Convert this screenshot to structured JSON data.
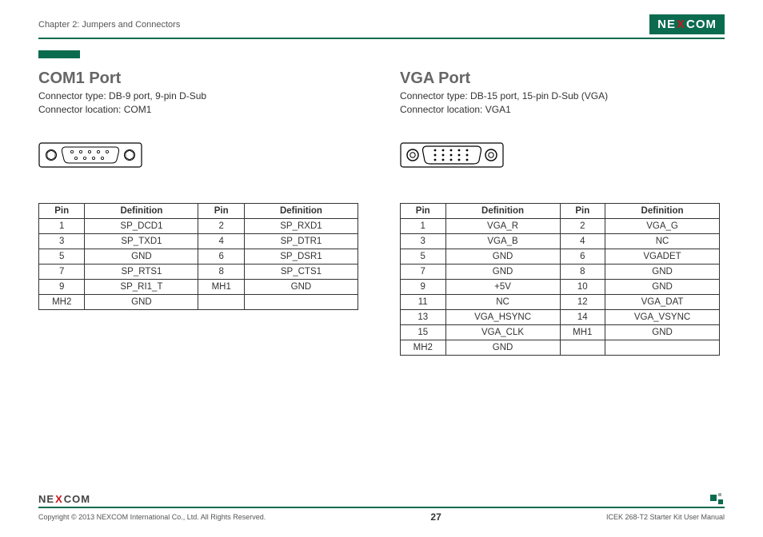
{
  "header": {
    "chapter": "Chapter 2: Jumpers and Connectors",
    "brand_left": "NE",
    "brand_x": "X",
    "brand_right": "COM"
  },
  "com1": {
    "title": "COM1 Port",
    "line1": "Connector type: DB-9 port, 9-pin D-Sub",
    "line2": "Connector location: COM1",
    "thead": {
      "pin": "Pin",
      "def": "Definition"
    },
    "rows": [
      {
        "p1": "1",
        "d1": "SP_DCD1",
        "p2": "2",
        "d2": "SP_RXD1"
      },
      {
        "p1": "3",
        "d1": "SP_TXD1",
        "p2": "4",
        "d2": "SP_DTR1"
      },
      {
        "p1": "5",
        "d1": "GND",
        "p2": "6",
        "d2": "SP_DSR1"
      },
      {
        "p1": "7",
        "d1": "SP_RTS1",
        "p2": "8",
        "d2": "SP_CTS1"
      },
      {
        "p1": "9",
        "d1": "SP_RI1_T",
        "p2": "MH1",
        "d2": "GND"
      },
      {
        "p1": "MH2",
        "d1": "GND",
        "p2": "",
        "d2": ""
      }
    ]
  },
  "vga": {
    "title": "VGA Port",
    "line1": "Connector type: DB-15 port, 15-pin D-Sub (VGA)",
    "line2": "Connector location: VGA1",
    "thead": {
      "pin": "Pin",
      "def": "Definition"
    },
    "rows": [
      {
        "p1": "1",
        "d1": "VGA_R",
        "p2": "2",
        "d2": "VGA_G"
      },
      {
        "p1": "3",
        "d1": "VGA_B",
        "p2": "4",
        "d2": "NC"
      },
      {
        "p1": "5",
        "d1": "GND",
        "p2": "6",
        "d2": "VGADET"
      },
      {
        "p1": "7",
        "d1": "GND",
        "p2": "8",
        "d2": "GND"
      },
      {
        "p1": "9",
        "d1": "+5V",
        "p2": "10",
        "d2": "GND"
      },
      {
        "p1": "11",
        "d1": "NC",
        "p2": "12",
        "d2": "VGA_DAT"
      },
      {
        "p1": "13",
        "d1": "VGA_HSYNC",
        "p2": "14",
        "d2": "VGA_VSYNC"
      },
      {
        "p1": "15",
        "d1": "VGA_CLK",
        "p2": "MH1",
        "d2": "GND"
      },
      {
        "p1": "MH2",
        "d1": "GND",
        "p2": "",
        "d2": ""
      }
    ]
  },
  "footer": {
    "copyright": "Copyright © 2013 NEXCOM International Co., Ltd. All Rights Reserved.",
    "page": "27",
    "manual": "ICEK 268-T2 Starter Kit User Manual",
    "brand_left": "NE",
    "brand_x": "X",
    "brand_right": "COM"
  }
}
